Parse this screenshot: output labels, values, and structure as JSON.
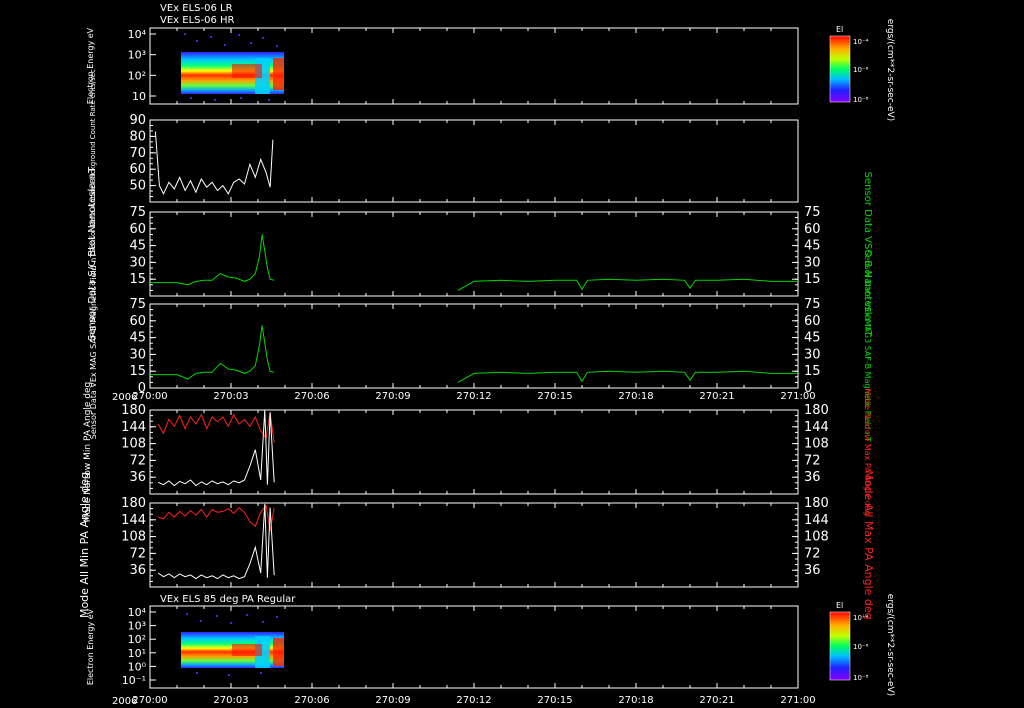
{
  "header": {
    "line1": "VEx ELS-06 LR",
    "line2": "VEx ELS-06 HR",
    "bottom_title": "VEx ELS 85 deg PA Regular",
    "year_label": "2006"
  },
  "colorbar": {
    "title": "El",
    "ticks": [
      "10⁻⁴",
      "10⁻⁶",
      "10⁻⁸"
    ],
    "units": "ergs/(cm**2-sr-sec-eV)"
  },
  "time_axis": {
    "ticks": [
      "270:00",
      "270:03",
      "270:06",
      "270:09",
      "270:12",
      "270:15",
      "270:18",
      "270:21",
      "271:00"
    ]
  },
  "chart_data": [
    {
      "type": "heatmap",
      "panel": "energy-spectrogram-top",
      "ylabel": "Electron Energy eV",
      "ytick_labels": [
        "10",
        "10²",
        "10³",
        "10⁴"
      ],
      "y_scale": "log",
      "data_extent_ticks": [
        0.7,
        4.6
      ]
    },
    {
      "type": "line",
      "panel": "background-counts",
      "ylabel": "Sensor Data Anode Background Count Rate cnts/sec",
      "ytick_labels": [
        "50",
        "60",
        "70",
        "80",
        "90"
      ],
      "ylim": [
        40,
        90
      ],
      "series": [
        {
          "color": "#ffffff",
          "x": [
            0.2,
            0.35,
            0.5,
            0.7,
            0.9,
            1.1,
            1.3,
            1.5,
            1.7,
            1.9,
            2.1,
            2.3,
            2.5,
            2.7,
            2.9,
            3.1,
            3.3,
            3.5,
            3.7,
            3.9,
            4.1,
            4.3,
            4.45,
            4.55
          ],
          "y": [
            83,
            50,
            45,
            52,
            48,
            55,
            47,
            53,
            46,
            54,
            49,
            52,
            47,
            50,
            45,
            52,
            54,
            51,
            63,
            55,
            66,
            58,
            49,
            78
          ]
        }
      ]
    },
    {
      "type": "line",
      "panel": "bmag",
      "ylabel": "Sensor Data S/C Btot Nanotesla nT",
      "ylabel_right": "Sensor Data VSO B Nanotesla nT",
      "ytick_labels": [
        "15",
        "30",
        "45",
        "60",
        "75"
      ],
      "ylim": [
        0,
        75
      ],
      "series": [
        {
          "color": "#00d800",
          "x": [
            0,
            0.5,
            1,
            1.4,
            1.7,
            2,
            2.3,
            2.6,
            2.9,
            3.2,
            3.5,
            3.7,
            3.9,
            4.05,
            4.15,
            4.25,
            4.35,
            4.45,
            4.6
          ],
          "y": [
            12,
            12,
            12,
            10,
            13,
            14,
            14,
            20,
            17,
            16,
            13,
            15,
            20,
            35,
            55,
            40,
            25,
            15,
            14
          ]
        },
        {
          "color": "#00d800",
          "x": [
            11.4,
            11.7,
            12,
            13,
            14,
            15,
            15.8,
            16,
            16.2,
            17,
            18,
            19,
            19.8,
            20,
            20.2,
            21,
            22,
            23,
            24
          ],
          "y": [
            5,
            9,
            13,
            14,
            13,
            14,
            14,
            6,
            14,
            15,
            14,
            15,
            14,
            7,
            14,
            14,
            15,
            13,
            13
          ]
        }
      ]
    },
    {
      "type": "line",
      "panel": "b-saf",
      "ylabel": "Sensor Data VEx MAG SAF-B Magnetic Field nT",
      "ylabel_right": "Sensor Data VEx MAG3 SAF-B Magnetic Field nT",
      "ytick_labels": [
        "0",
        "15",
        "30",
        "45",
        "60",
        "75"
      ],
      "ylim": [
        0,
        75
      ],
      "series": [
        {
          "color": "#00d800",
          "x": [
            0,
            0.5,
            1,
            1.4,
            1.7,
            2,
            2.3,
            2.6,
            2.9,
            3.2,
            3.5,
            3.7,
            3.9,
            4.05,
            4.15,
            4.25,
            4.35,
            4.45,
            4.6
          ],
          "y": [
            12,
            12,
            12,
            8,
            13,
            14,
            14,
            22,
            17,
            16,
            13,
            15,
            20,
            38,
            56,
            40,
            25,
            15,
            14
          ]
        },
        {
          "color": "#00d800",
          "x": [
            11.4,
            11.7,
            12,
            13,
            14,
            15,
            15.8,
            16,
            16.2,
            17,
            18,
            19,
            19.8,
            20,
            20.2,
            21,
            22,
            23,
            24
          ],
          "y": [
            5,
            9,
            13,
            14,
            13,
            14,
            14,
            6,
            14,
            15,
            14,
            15,
            14,
            7,
            14,
            14,
            15,
            13,
            13
          ]
        }
      ]
    },
    {
      "type": "line",
      "panel": "narrow-pa",
      "ylabel": "Mode Narrow Min PA Angle deg",
      "ylabel_right": "Mode Narrow Max PA Angle deg",
      "ytick_labels": [
        "36",
        "72",
        "108",
        "144",
        "180"
      ],
      "ylim": [
        0,
        180
      ],
      "series": [
        {
          "color": "#ff2020",
          "x": [
            0.3,
            0.5,
            0.7,
            0.9,
            1.1,
            1.3,
            1.5,
            1.7,
            1.9,
            2.1,
            2.3,
            2.5,
            2.7,
            2.9,
            3.1,
            3.3,
            3.5,
            3.7,
            3.9,
            4.1,
            4.3,
            4.45,
            4.6
          ],
          "y": [
            150,
            130,
            160,
            145,
            168,
            140,
            165,
            150,
            170,
            140,
            165,
            155,
            165,
            145,
            170,
            150,
            160,
            145,
            165,
            135,
            120,
            175,
            110
          ]
        },
        {
          "color": "#ffffff",
          "x": [
            0.3,
            0.5,
            0.7,
            0.9,
            1.1,
            1.3,
            1.5,
            1.7,
            1.9,
            2.1,
            2.3,
            2.5,
            2.7,
            2.9,
            3.1,
            3.3,
            3.5,
            3.7,
            3.9,
            4.1,
            4.25,
            4.35,
            4.45,
            4.6
          ],
          "y": [
            25,
            20,
            28,
            18,
            27,
            22,
            30,
            18,
            26,
            20,
            28,
            22,
            26,
            20,
            28,
            24,
            30,
            60,
            95,
            30,
            180,
            20,
            175,
            25
          ]
        }
      ]
    },
    {
      "type": "line",
      "panel": "all-pa",
      "ylabel": "Mode All Min PA Angle deg",
      "ylabel_right": "Mode All Max PA Angle deg",
      "ytick_labels": [
        "36",
        "72",
        "108",
        "144",
        "180"
      ],
      "ylim": [
        0,
        180
      ],
      "series": [
        {
          "color": "#ff2020",
          "x": [
            0.3,
            0.5,
            0.7,
            0.9,
            1.1,
            1.3,
            1.5,
            1.7,
            1.9,
            2.1,
            2.3,
            2.5,
            2.7,
            2.9,
            3.1,
            3.3,
            3.5,
            3.7,
            3.9,
            4.1,
            4.3,
            4.45,
            4.6
          ],
          "y": [
            150,
            146,
            160,
            150,
            162,
            152,
            164,
            154,
            166,
            150,
            166,
            160,
            162,
            168,
            158,
            170,
            160,
            140,
            130,
            160,
            175,
            120,
            170
          ]
        },
        {
          "color": "#ffffff",
          "x": [
            0.3,
            0.5,
            0.7,
            0.9,
            1.1,
            1.3,
            1.5,
            1.7,
            1.9,
            2.1,
            2.3,
            2.5,
            2.7,
            2.9,
            3.1,
            3.3,
            3.5,
            3.7,
            3.9,
            4.1,
            4.25,
            4.35,
            4.45,
            4.6
          ],
          "y": [
            30,
            22,
            28,
            20,
            28,
            22,
            26,
            18,
            26,
            20,
            24,
            18,
            26,
            20,
            24,
            18,
            22,
            50,
            85,
            30,
            178,
            20,
            170,
            25
          ]
        }
      ]
    },
    {
      "type": "heatmap",
      "panel": "energy-spectrogram-bottom",
      "ylabel": "Electron Energy eV",
      "ytick_labels": [
        "10⁻¹",
        "10⁰",
        "10¹",
        "10²",
        "10³",
        "10⁴"
      ],
      "y_scale": "log",
      "data_extent_ticks": [
        1.0,
        5.6
      ]
    }
  ]
}
